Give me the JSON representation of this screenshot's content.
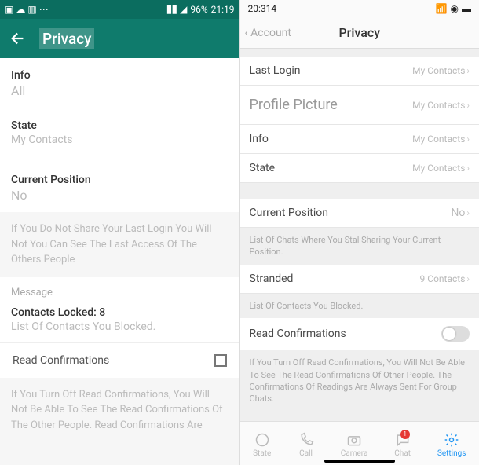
{
  "android": {
    "status": {
      "battery": "96%",
      "time": "21:19"
    },
    "title": "Privacy",
    "info_label": "Info",
    "info_value": "All",
    "state_label": "State",
    "state_value": "My Contacts",
    "position_label": "Current Position",
    "position_value": "No",
    "login_note": "If You Do Not Share Your Last Login You Will Not You Can See The Last Access Of The Others People",
    "message_header": "Message",
    "locked_label": "Contacts Locked: 8",
    "locked_caption": "List Of Contacts You Blocked.",
    "read_label": "Read Confirmations",
    "read_note": "If You Turn Off Read Confirmations, You Will Not Be Able To See The Read Confirmations Of The Other People. Read Confirmations Are"
  },
  "ios": {
    "status_time": "20:314",
    "nav_back": "‹ Account",
    "nav_title": "Privacy",
    "rows": {
      "last_login": {
        "label": "Last Login",
        "value": "My Contacts"
      },
      "profile_picture": {
        "label": "Profile Picture",
        "value": "My Contacts"
      },
      "info": {
        "label": "Info",
        "value": "My Contacts"
      },
      "state": {
        "label": "State",
        "value": "My Contacts"
      },
      "position": {
        "label": "Current Position",
        "value": "No"
      },
      "stranded": {
        "label": "Stranded",
        "value": "9 Contacts"
      }
    },
    "position_caption": "List Of Chats Where You Stal Sharing Your Current Position.",
    "blocked_caption": "List Of Contacts You Blocked.",
    "read_label": "Read Confirmations",
    "read_caption": "If You Turn Off Read Confirmations, You Will Not Be Able To See The Read Confirmations Of Other People. The Confirmations Of Readings Are Always  Sent For Group Chats.",
    "tabs": {
      "state": "State",
      "call": "Call",
      "camera": "Camera",
      "chat": "Chat",
      "settings": "Settings",
      "chat_badge": "1"
    }
  }
}
